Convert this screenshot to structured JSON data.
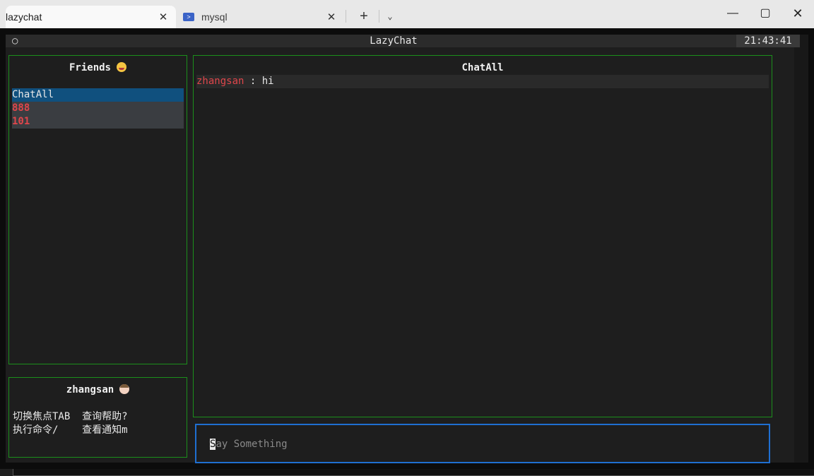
{
  "tabs": [
    {
      "label": "lazychat",
      "icon": "terminal-icon",
      "active": true
    },
    {
      "label": "mysql",
      "icon": "powershell-icon",
      "active": false
    }
  ],
  "window_controls": {
    "minimize": "—",
    "maximize": "▢",
    "close": "✕",
    "new_tab": "+",
    "dropdown": "⌄"
  },
  "app_header": {
    "indicator": "○",
    "title": "LazyChat",
    "clock": "21:43:41"
  },
  "friends_panel": {
    "title": "Friends",
    "items": [
      {
        "label": "ChatAll",
        "selected": true
      },
      {
        "label": "888",
        "selected": false
      },
      {
        "label": "101",
        "selected": false
      }
    ]
  },
  "profile_panel": {
    "username": "zhangsan",
    "shortcuts_line1": "切换焦点TAB  查询帮助?",
    "shortcuts_line2": "执行命令/    查看通知m"
  },
  "chat_panel": {
    "title": "ChatAll",
    "messages": [
      {
        "user": "zhangsan",
        "separator": " : ",
        "text": "hi"
      }
    ]
  },
  "input": {
    "cursor_char": "S",
    "placeholder_rest": "ay Something"
  },
  "colors": {
    "border": "#1b8f1b",
    "input_border": "#1f6fd1",
    "selected": "#10507e",
    "name_red": "#e0464b"
  }
}
